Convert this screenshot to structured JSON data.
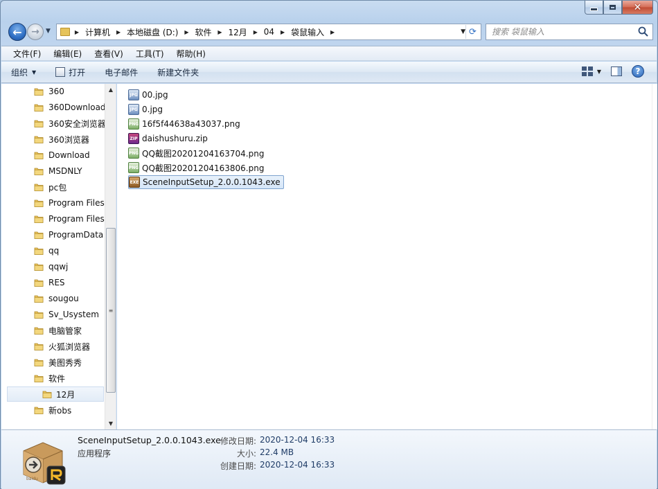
{
  "window": {
    "caption_min": "–",
    "caption_max": "□",
    "caption_close": "✕"
  },
  "address": {
    "crumbs": [
      "计算机",
      "本地磁盘 (D:)",
      "软件",
      "12月",
      "04",
      "袋鼠输入"
    ]
  },
  "search": {
    "placeholder": "搜索 袋鼠输入"
  },
  "menu": [
    "文件(F)",
    "编辑(E)",
    "查看(V)",
    "工具(T)",
    "帮助(H)"
  ],
  "commands": {
    "organize": "组织",
    "open": "打开",
    "email": "电子邮件",
    "new_folder": "新建文件夹"
  },
  "nav_tree": [
    "360",
    "360Download",
    "360安全浏览器",
    "360浏览器",
    "Download",
    "MSDNLY",
    "pc包",
    "Program Files",
    "Program Files",
    "ProgramData",
    "qq",
    "qqwj",
    "RES",
    "sougou",
    "Sv_Usystem",
    "电脑管家",
    "火狐浏览器",
    "美图秀秀",
    "软件",
    "12月",
    "新obs"
  ],
  "files": [
    {
      "name": "00.jpg",
      "type": "jpg",
      "icon_text": "JPG"
    },
    {
      "name": "0.jpg",
      "type": "jpg",
      "icon_text": "JPG"
    },
    {
      "name": "16f5f44638a43037.png",
      "type": "png",
      "icon_text": "PNG"
    },
    {
      "name": "daishushuru.zip",
      "type": "zip",
      "icon_text": "ZIP"
    },
    {
      "name": "QQ截图20201204163704.png",
      "type": "png",
      "icon_text": "PNG"
    },
    {
      "name": "QQ截图20201204163806.png",
      "type": "png",
      "icon_text": "PNG"
    },
    {
      "name": "SceneInputSetup_2.0.0.1043.exe",
      "type": "exe",
      "icon_text": "EXE"
    }
  ],
  "details": {
    "name": "SceneInputSetup_2.0.0.1043.exe",
    "type": "应用程序",
    "modified_label": "修改日期:",
    "modified_value": "2020-12-04 16:33",
    "size_label": "大小:",
    "size_value": "22.4 MB",
    "created_label": "创建日期:",
    "created_value": "2020-12-04 16:33",
    "icon_caption": "baidu"
  }
}
